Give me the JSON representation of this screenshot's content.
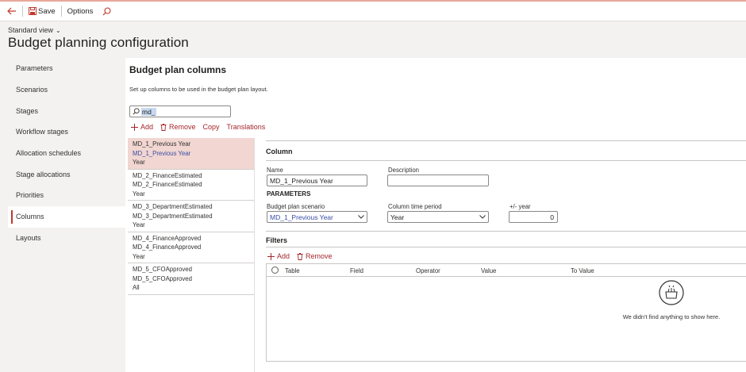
{
  "toolbar": {
    "save_label": "Save",
    "options_label": "Options"
  },
  "header": {
    "view_label": "Standard view",
    "page_title": "Budget planning configuration"
  },
  "nav": {
    "items": [
      {
        "label": "Parameters"
      },
      {
        "label": "Scenarios"
      },
      {
        "label": "Stages"
      },
      {
        "label": "Workflow stages"
      },
      {
        "label": "Allocation schedules"
      },
      {
        "label": "Stage allocations"
      },
      {
        "label": "Priorities"
      },
      {
        "label": "Columns"
      },
      {
        "label": "Layouts"
      }
    ],
    "active_index": 7
  },
  "main": {
    "title": "Budget plan columns",
    "description": "Set up columns to be used in the budget plan layout.",
    "filter_value": "md_",
    "actions": {
      "add": "Add",
      "remove": "Remove",
      "copy": "Copy",
      "translations": "Translations"
    }
  },
  "list": [
    {
      "line1": "MD_1_Previous Year",
      "line2": "MD_1_Previous Year",
      "line3": "Year"
    },
    {
      "line1": "MD_2_FinanceEstimated",
      "line2": "MD_2_FinanceEstimated",
      "line3": "Year"
    },
    {
      "line1": "MD_3_DepartmentEstimated",
      "line2": "MD_3_DepartmentEstimated",
      "line3": "Year"
    },
    {
      "line1": "MD_4_FinanceApproved",
      "line2": "MD_4_FinanceApproved",
      "line3": "Year"
    },
    {
      "line1": "MD_5_CFOApproved",
      "line2": "MD_5_CFOApproved",
      "line3": "All"
    }
  ],
  "detail": {
    "column_header": "Column",
    "name_label": "Name",
    "name_value": "MD_1_Previous Year",
    "description_label": "Description",
    "description_value": "",
    "parameters_header": "PARAMETERS",
    "scenario_label": "Budget plan scenario",
    "scenario_value": "MD_1_Previous Year",
    "period_label": "Column time period",
    "period_value": "Year",
    "year_label": "+/- year",
    "year_value": "0",
    "filters_header": "Filters",
    "filters_actions": {
      "add": "Add",
      "remove": "Remove"
    },
    "grid_columns": [
      "Table",
      "Field",
      "Operator",
      "Value",
      "To Value"
    ],
    "empty_text": "We didn't find anything to show here."
  },
  "colors": {
    "accent": "#c0392b",
    "selection": "#f1d6d1",
    "link": "#3a4ea5"
  }
}
